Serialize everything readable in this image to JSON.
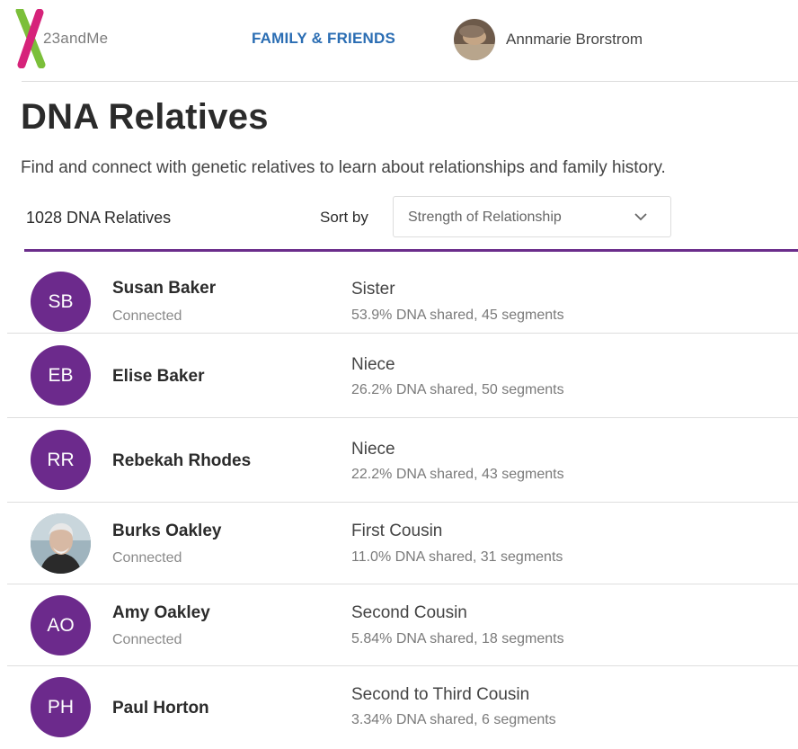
{
  "nav": {
    "logo_text": "23andMe",
    "family_link": "FAMILY & FRIENDS",
    "user_name": "Annmarie Brorstrom"
  },
  "page": {
    "title": "DNA Relatives",
    "subtitle": "Find and connect with genetic relatives to learn about relationships and family history.",
    "count_label": "1028 DNA Relatives",
    "sort_label": "Sort by",
    "sort_value": "Strength of Relationship"
  },
  "colors": {
    "brand_purple": "#6c2a8c",
    "link_blue": "#2a6db3",
    "logo_green": "#7bbf3a",
    "logo_pink": "#d6237a"
  },
  "relatives": [
    {
      "initials": "SB",
      "name": "Susan Baker",
      "status": "Connected",
      "relationship": "Sister",
      "shared": "53.9% DNA shared, 45 segments"
    },
    {
      "initials": "EB",
      "name": "Elise Baker",
      "status": "",
      "relationship": "Niece",
      "shared": "26.2% DNA shared, 50 segments"
    },
    {
      "initials": "RR",
      "name": "Rebekah Rhodes",
      "status": "",
      "relationship": "Niece",
      "shared": "22.2% DNA shared, 43 segments"
    },
    {
      "initials": "",
      "name": "Burks Oakley",
      "status": "Connected",
      "relationship": "First Cousin",
      "shared": "11.0% DNA shared, 31 segments"
    },
    {
      "initials": "AO",
      "name": "Amy Oakley",
      "status": "Connected",
      "relationship": "Second Cousin",
      "shared": "5.84% DNA shared, 18 segments"
    },
    {
      "initials": "PH",
      "name": "Paul Horton",
      "status": "",
      "relationship": "Second to Third Cousin",
      "shared": "3.34% DNA shared, 6 segments"
    }
  ]
}
